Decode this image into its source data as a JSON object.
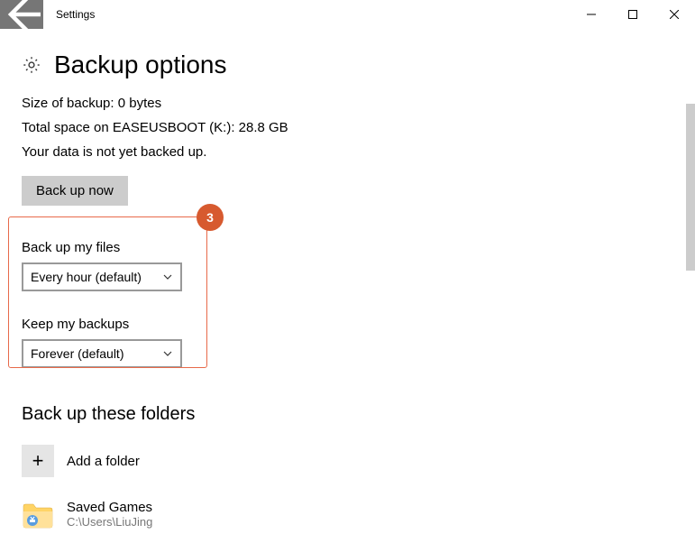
{
  "window": {
    "title": "Settings"
  },
  "page": {
    "title": "Backup options",
    "info_size": "Size of backup: 0 bytes",
    "info_space": "Total space on EASEUSBOOT (K:): 28.8 GB",
    "info_status": "Your data is not yet backed up.",
    "backup_now": "Back up now"
  },
  "frequency": {
    "label": "Back up my files",
    "value": "Every hour (default)"
  },
  "retention": {
    "label": "Keep my backups",
    "value": "Forever (default)"
  },
  "folders": {
    "heading": "Back up these folders",
    "add_label": "Add a folder",
    "item": {
      "name": "Saved Games",
      "path": "C:\\Users\\LiuJing"
    }
  },
  "callout": {
    "badge": "3"
  }
}
